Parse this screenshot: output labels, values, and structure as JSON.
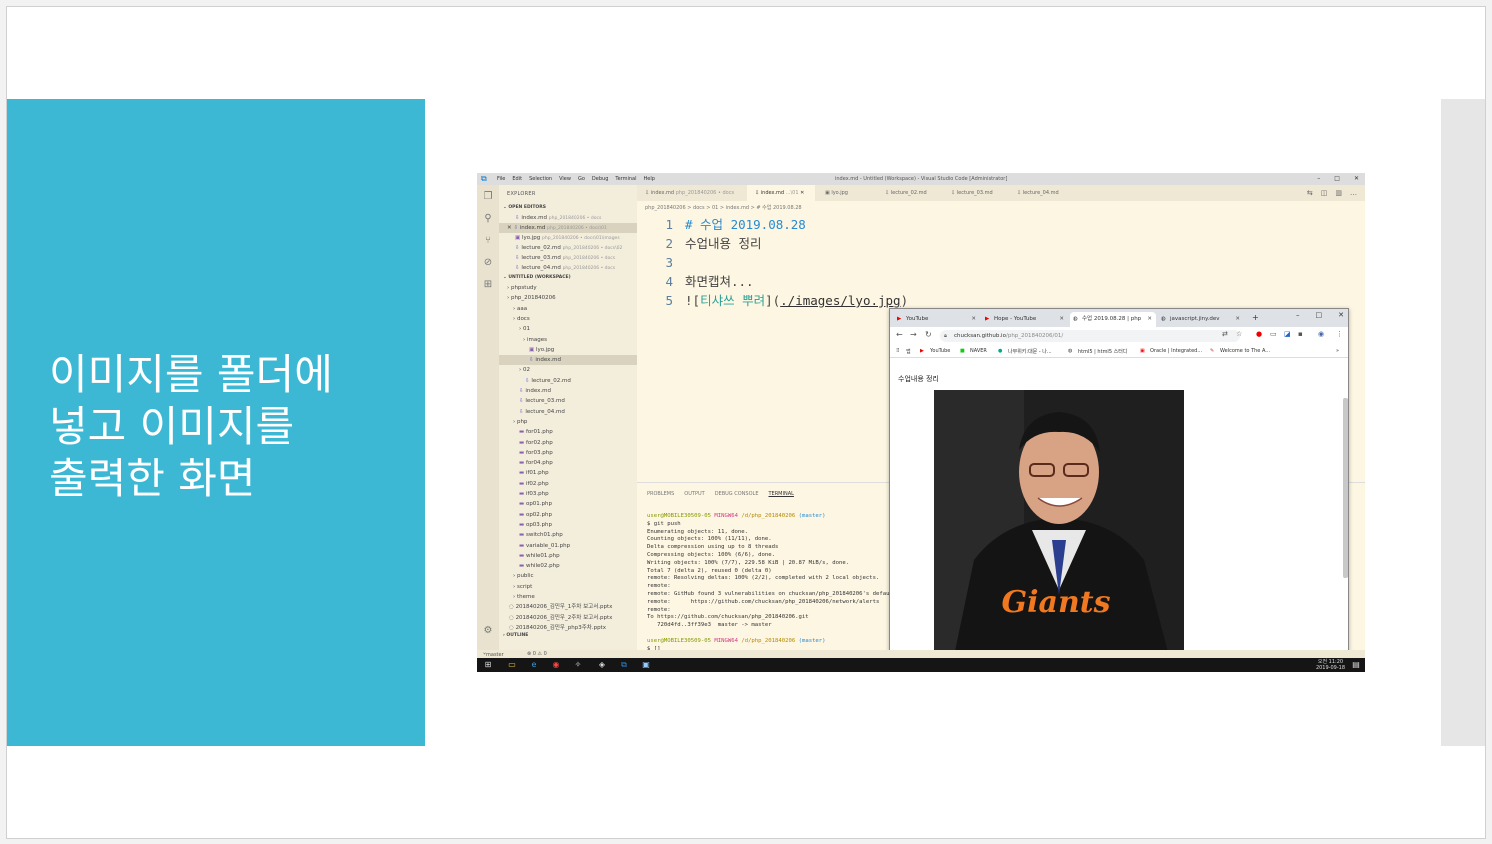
{
  "slide": {
    "title_lines": [
      "이미지를 폴더에",
      "넣고 이미지를",
      "출력한 화면"
    ]
  },
  "vscode": {
    "menu": [
      "File",
      "Edit",
      "Selection",
      "View",
      "Go",
      "Debug",
      "Terminal",
      "Help"
    ],
    "window_title": "index.md - Untitled (Workspace) - Visual Studio Code [Administrator]",
    "window_controls": [
      "–",
      "□",
      "✕"
    ],
    "sidebar": {
      "header": "EXPLORER",
      "open_editors": "OPEN EDITORS",
      "workspace": "UNTITLED (WORKSPACE)",
      "outline": "OUTLINE",
      "open_files": [
        {
          "name": "index.md",
          "path": "php_201840206 • docs"
        },
        {
          "name": "index.md",
          "path": "php_201840206 • docs\\01"
        },
        {
          "name": "lyo.jpg",
          "path": "php_201840206 • docs\\01\\images"
        },
        {
          "name": "lecture_02.md",
          "path": "php_201840206 • docs\\02"
        },
        {
          "name": "lecture_03.md",
          "path": "php_201840206 • docs"
        },
        {
          "name": "lecture_04.md",
          "path": "php_201840206 • docs"
        }
      ],
      "tree": [
        "phpstudy",
        "php_201840206",
        "aaa",
        "docs",
        "01",
        "images",
        "lyo.jpg",
        "index.md",
        "02",
        "lecture_02.md",
        "index.md",
        "lecture_03.md",
        "lecture_04.md",
        "php",
        "for01.php",
        "for02.php",
        "for03.php",
        "for04.php",
        "if01.php",
        "if02.php",
        "if03.php",
        "op01.php",
        "op02.php",
        "op03.php",
        "switch01.php",
        "variable_01.php",
        "while01.php",
        "while02.php",
        "public",
        "script",
        "theme",
        "201840206_김민우_1주차 보고서.pptx",
        "201840206_김민우_2주차 보고서.pptx",
        "201840206_김민우_php3주차.pptx"
      ]
    },
    "tabs": [
      {
        "label": "index.md",
        "sub": "php_201840206 • docs"
      },
      {
        "label": "index.md",
        "sub": "...\\01"
      },
      {
        "label": "lyo.jpg",
        "sub": ""
      },
      {
        "label": "lecture_02.md",
        "sub": ""
      },
      {
        "label": "lecture_03.md",
        "sub": ""
      },
      {
        "label": "lecture_04.md",
        "sub": ""
      }
    ],
    "breadcrumb": "php_201840206 > docs > 01 > index.md > # 수업 2019.08.28",
    "code": {
      "line1": "# 수업 2019.08.28",
      "line2": "수업내용 정리",
      "line3": "",
      "line4": "화면캡쳐...",
      "line5_prefix": "![",
      "line5_alt": "티샤쓰 뿌려",
      "line5_mid": "](",
      "line5_url": "./images/lyo.jpg",
      "line5_suffix": ")"
    },
    "panel_tabs": [
      "PROBLEMS",
      "OUTPUT",
      "DEBUG CONSOLE",
      "TERMINAL"
    ],
    "terminal": {
      "prompt_user": "user@MOBILE30509-05",
      "prompt_env": "MINGW64",
      "prompt_path": "/d/php_201840206",
      "prompt_branch": "(master)",
      "lines": [
        "$ git push",
        "Enumerating objects: 11, done.",
        "Counting objects: 100% (11/11), done.",
        "Delta compression using up to 8 threads",
        "Compressing objects: 100% (6/6), done.",
        "Writing objects: 100% (7/7), 229.58 KiB | 20.87 MiB/s, done.",
        "Total 7 (delta 2), reused 0 (delta 0)",
        "remote: Resolving deltas: 100% (2/2), completed with 2 local objects.",
        "remote:",
        "remote: GitHub found 3 vulnerabilities on chucksan/php_201840206's default",
        "remote:      https://github.com/chucksan/php_201840206/network/alerts",
        "remote:",
        "To https://github.com/chucksan/php_201840206.git",
        "   720d4fd..3ff39e3  master -> master"
      ],
      "last_line": "$ []"
    },
    "status": {
      "branch": "master",
      "errors": "⊗ 0 ⚠ 0"
    },
    "clock": {
      "time": "오전 11:20",
      "date": "2019-09-18"
    }
  },
  "chrome": {
    "tabs": [
      {
        "label": "YouTube",
        "active": false
      },
      {
        "label": "Hope - YouTube",
        "active": false
      },
      {
        "label": "수업 2019.08.28 | php",
        "active": true
      },
      {
        "label": "javascript.jiny.dev",
        "active": false
      }
    ],
    "new_tab": "+",
    "controls": [
      "–",
      "□",
      "✕"
    ],
    "url_host": "chucksan.github.io",
    "url_path": "/php_201840206/01/",
    "bookmarks": [
      "앱",
      "YouTube",
      "NAVER",
      "나무위키:대문 - 나...",
      "html5 | html5 스터디",
      "Oracle | Integrated...",
      "Welcome to The A..."
    ],
    "bookmarks_more": "»",
    "page_text": "수업내용 정리"
  },
  "colors": {
    "slide_panel": "#3db8d4",
    "editor_bg": "#fdf6e3",
    "sidebar_bg": "#f3eddc"
  }
}
